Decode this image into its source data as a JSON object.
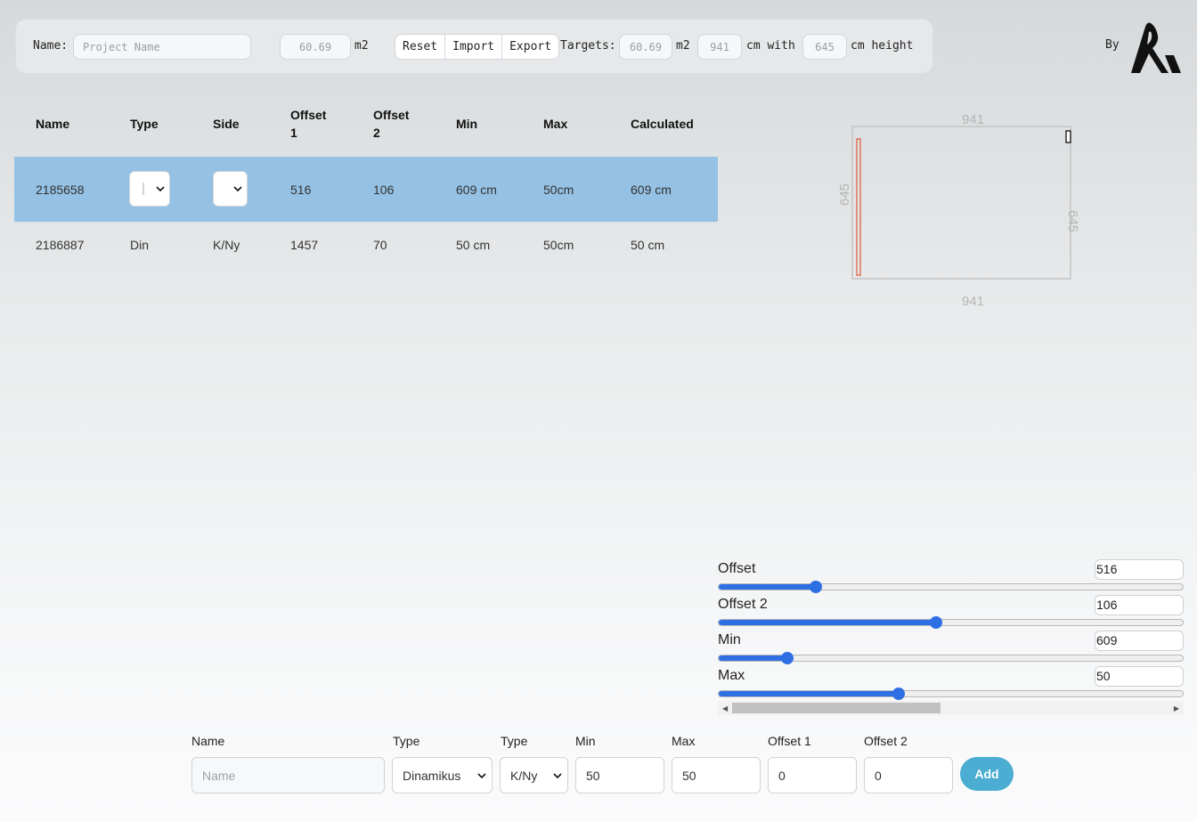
{
  "toolbar": {
    "name_label": "Name:",
    "name_placeholder": "Project Name",
    "area_value": "60.69",
    "area_unit": "m2",
    "buttons": [
      "Reset",
      "Import",
      "Export"
    ],
    "targets_label": "Targets:",
    "target_area": "60.69",
    "target_area_unit": "m2",
    "target_width": "941",
    "cm_with": "cm with",
    "target_height": "645",
    "cm_height": "cm height"
  },
  "brand": {
    "by": "By"
  },
  "table": {
    "headers": [
      "Name",
      "Type",
      "Side",
      "Offset\n1",
      "Offset\n2",
      "Min",
      "Max",
      "Calculated"
    ],
    "rows": [
      {
        "name": "2185658",
        "type": "",
        "side": "",
        "offset1": "516",
        "offset2": "106",
        "min": "609 cm",
        "max": "50cm",
        "calculated": "609 cm",
        "selected": true
      },
      {
        "name": "2186887",
        "type": "Din",
        "side": "K/Ny",
        "offset1": "1457",
        "offset2": "70",
        "min": "50 cm",
        "max": "50cm",
        "calculated": "50 cm",
        "selected": false
      }
    ]
  },
  "diagram": {
    "top": "941",
    "bottom": "941",
    "left": "645",
    "right": "645"
  },
  "sliders": [
    {
      "label": "Offset",
      "value": "516",
      "fraction": 0.21
    },
    {
      "label": "Offset 2",
      "value": "106",
      "fraction": 0.469
    },
    {
      "label": "Min",
      "value": "609",
      "fraction": 0.149
    },
    {
      "label": "Max",
      "value": "50",
      "fraction": 0.389
    }
  ],
  "form": {
    "labels": [
      "Name",
      "Type",
      "Type",
      "Min",
      "Max",
      "Offset 1",
      "Offset 2"
    ],
    "name_placeholder": "Name",
    "type_value": "Dinamikus",
    "side_value": "K/Ny",
    "min_value": "50",
    "max_value": "50",
    "offset1_value": "0",
    "offset2_value": "0",
    "add_label": "Add"
  },
  "colors": {
    "selected_row": "#94c1e4",
    "slider": "#2f6fe4",
    "add_button": "#4aadd1",
    "diagram_piece": "#e05a3a"
  }
}
